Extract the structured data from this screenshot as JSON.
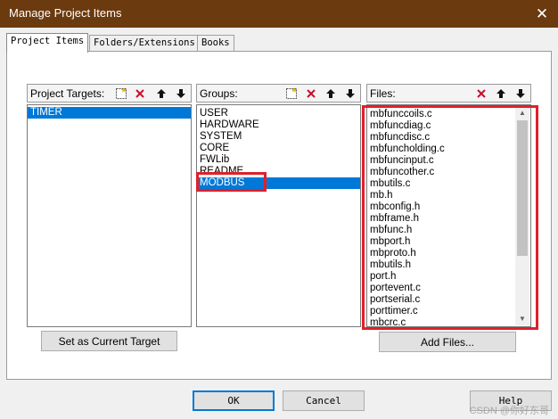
{
  "window": {
    "title": "Manage Project Items",
    "close_glyph": "✕"
  },
  "tabs": [
    {
      "label": "Project Items"
    },
    {
      "label": "Folders/Extensions"
    },
    {
      "label": "Books"
    }
  ],
  "targets": {
    "header": "Project Targets:",
    "items": [
      "TIMER"
    ],
    "selected": "TIMER"
  },
  "groups": {
    "header": "Groups:",
    "items": [
      "USER",
      "HARDWARE",
      "SYSTEM",
      "CORE",
      "FWLib",
      "README",
      "MODBUS"
    ],
    "selected": "MODBUS"
  },
  "files": {
    "header": "Files:",
    "items": [
      "mbfunccoils.c",
      "mbfuncdiag.c",
      "mbfuncdisc.c",
      "mbfuncholding.c",
      "mbfuncinput.c",
      "mbfuncother.c",
      "mbutils.c",
      "mb.h",
      "mbconfig.h",
      "mbframe.h",
      "mbfunc.h",
      "mbport.h",
      "mbproto.h",
      "mbutils.h",
      "port.h",
      "portevent.c",
      "portserial.c",
      "porttimer.c",
      "mbcrc.c"
    ]
  },
  "buttons": {
    "set_target": "Set as Current Target",
    "add_files": "Add Files...",
    "ok": "OK",
    "cancel": "Cancel",
    "help": "Help"
  },
  "icons": {
    "new": "new-item-icon",
    "delete": "delete-icon",
    "up": "move-up-icon",
    "down": "move-down-icon"
  },
  "colors": {
    "titlebar": "#6b3a0f",
    "selection": "#0078d7",
    "annotation": "#e0202a"
  },
  "watermark": "CSDN @你好东哥"
}
